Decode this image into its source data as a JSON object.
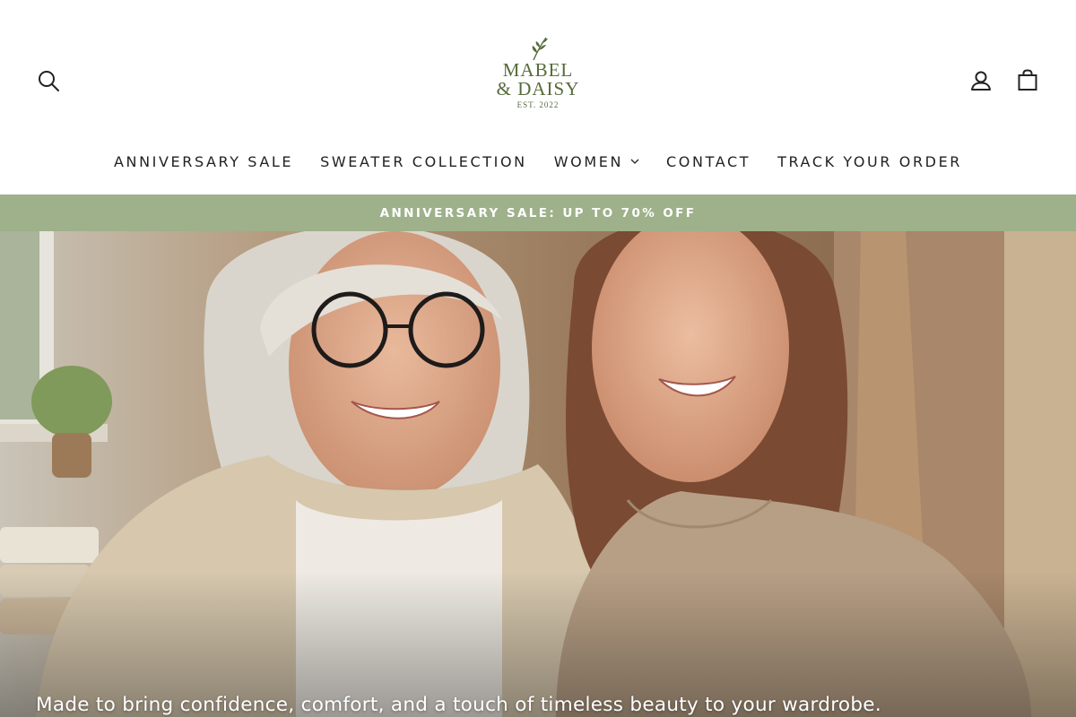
{
  "header": {
    "logo": {
      "line1": "MABEL",
      "line2": "& DAISY",
      "est": "EST. 2022"
    },
    "icons": {
      "search": "search-icon",
      "account": "user-icon",
      "cart": "shopping-bag-icon"
    }
  },
  "nav": {
    "items": [
      {
        "label": "ANNIVERSARY SALE"
      },
      {
        "label": "SWEATER COLLECTION"
      },
      {
        "label": "WOMEN",
        "has_dropdown": true
      },
      {
        "label": "CONTACT"
      },
      {
        "label": "TRACK YOUR ORDER"
      }
    ]
  },
  "announcement": {
    "text": "ANNIVERSARY SALE: UP TO 70% OFF",
    "background": "#9eb18a"
  },
  "hero": {
    "caption": "Made to bring confidence, comfort, and a touch of timeless beauty to your wardrobe."
  },
  "colors": {
    "brand_green": "#556b3a",
    "announcement_bg": "#9eb18a",
    "text": "#1e1e1e"
  }
}
